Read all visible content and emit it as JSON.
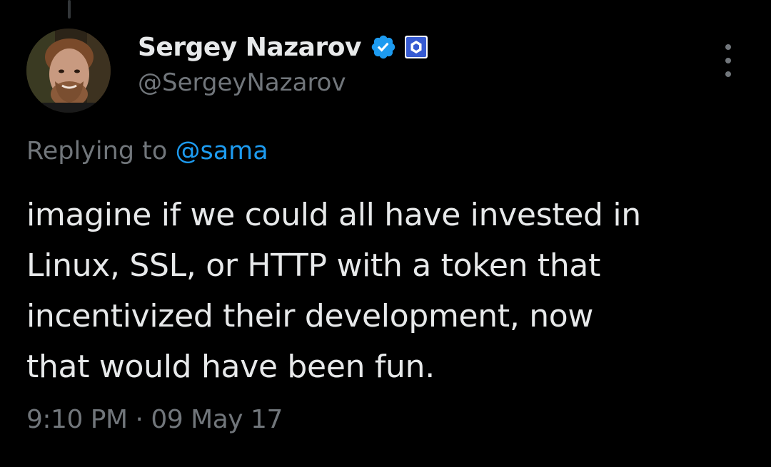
{
  "author": {
    "display_name": "Sergey Nazarov",
    "handle": "@SergeyNazarov",
    "verified": true,
    "verified_icon": "verified-badge-icon",
    "affiliate_icon": "chainlink-affiliate-icon"
  },
  "reply": {
    "prefix": "Replying to",
    "mention": "@sama"
  },
  "tweet": {
    "lines": [
      "imagine if we could all have invested in",
      "Linux, SSL, or HTTP with a token that",
      "incentivized their development, now",
      "that would have been fun."
    ]
  },
  "meta": {
    "time": "9:10 PM",
    "separator": "·",
    "date": "09 May 17"
  },
  "colors": {
    "background": "#000000",
    "text": "#e7e9ea",
    "muted": "#71767b",
    "accent": "#1d9bf0",
    "chainlink": "#375bd2"
  }
}
